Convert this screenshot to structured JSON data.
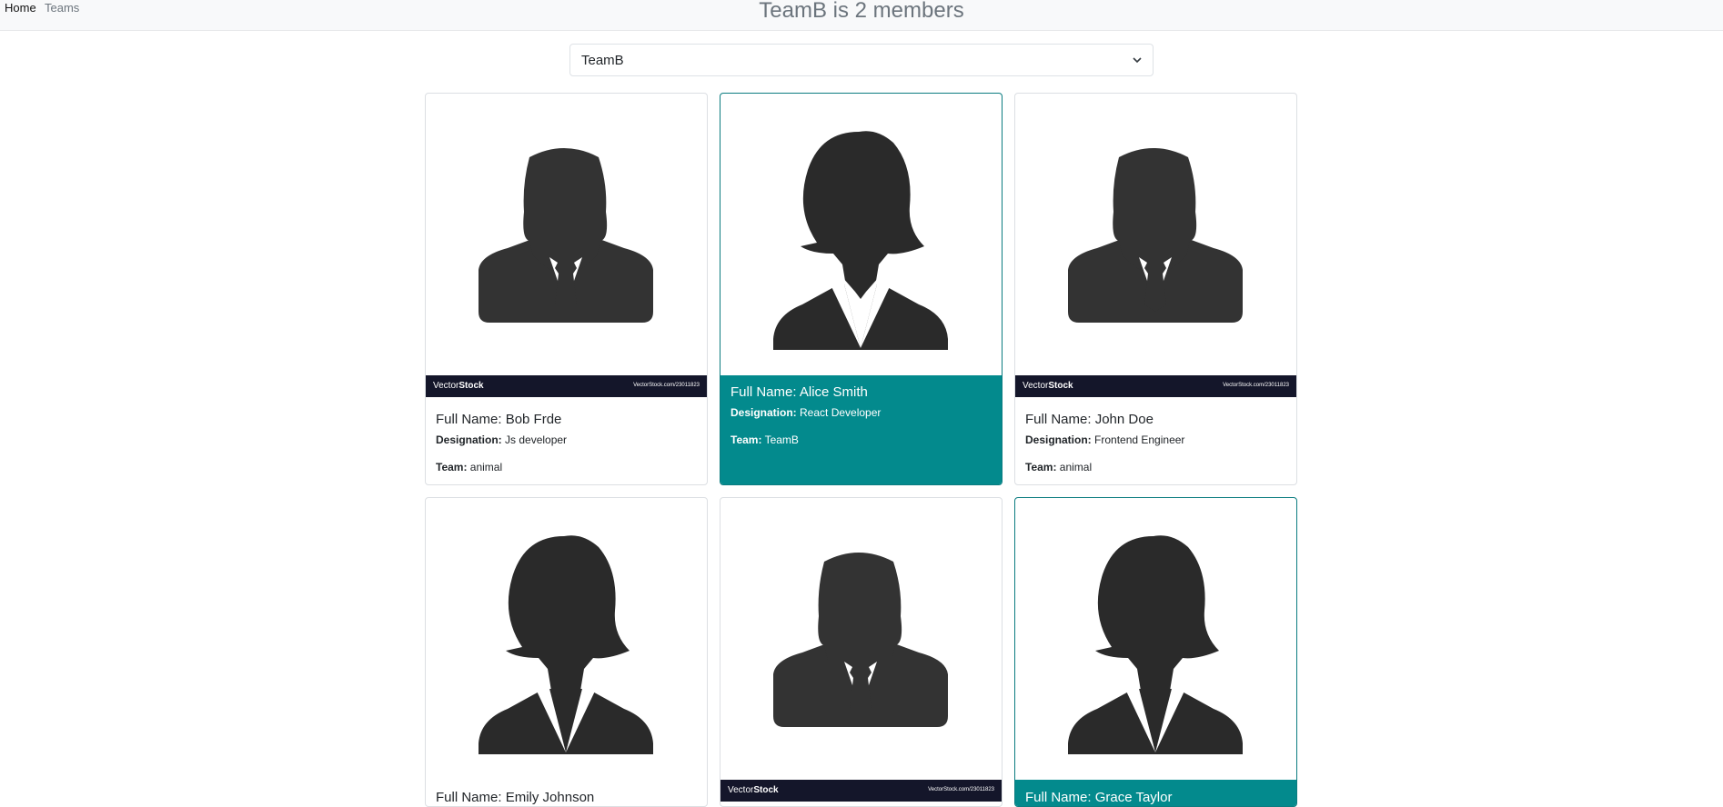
{
  "nav": {
    "home": "Home",
    "teams": "Teams"
  },
  "page_title": "TeamB is 2 members",
  "team_select": {
    "value": "TeamB"
  },
  "watermark": {
    "brand_a": "Vector",
    "brand_b": "Stock",
    "ref": "VectorStock.com/23011823"
  },
  "labels": {
    "full_name": "Full Name:",
    "designation": "Designation:",
    "team": "Team:"
  },
  "colors": {
    "selected_bg": "#038a8d",
    "selected_border": "#0b7c80",
    "title": "#6c757d"
  },
  "members": [
    {
      "name": "Bob Frde",
      "designation": "Js developer",
      "team": "animal",
      "avatar": "male-avatar-icon",
      "selected": false
    },
    {
      "name": "Alice Smith",
      "designation": "React Developer",
      "team": "TeamB",
      "avatar": "female-avatar-icon",
      "selected": true
    },
    {
      "name": "John Doe",
      "designation": "Frontend Engineer",
      "team": "animal",
      "avatar": "male-avatar-icon",
      "selected": false
    },
    {
      "name": "Emily Johnson",
      "designation": "",
      "team": "",
      "avatar": "female-avatar-icon",
      "selected": false
    },
    {
      "name": "",
      "designation": "",
      "team": "",
      "avatar": "male-avatar-icon",
      "selected": false
    },
    {
      "name": "Grace Taylor",
      "designation": "",
      "team": "",
      "avatar": "female-avatar-icon",
      "selected": true
    }
  ]
}
